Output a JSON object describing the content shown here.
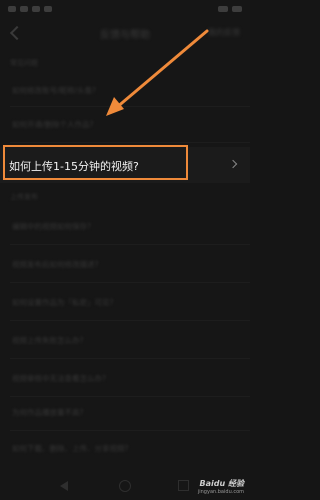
{
  "header": {
    "title": "反馈与帮助",
    "action": "我的反馈"
  },
  "sections": {
    "common": "常见问题",
    "upload": "上传发布"
  },
  "rows": [
    "如何修改账号/昵称/头像?",
    "如何开通/删除个人作品?",
    "如何上传1-15分钟的视频?",
    "编辑中的视频如何保存?",
    "视频发布后如何修改描述?",
    "如何设置作品为「私密」可见?",
    "视频上传失败怎么办?",
    "视频审核中无法查看怎么办?",
    "为何作品播放量不高?",
    "如何下载、删除、上传、分享视频?"
  ],
  "highlight": {
    "text": "如何上传1-15分钟的视频?"
  },
  "watermark": {
    "line1": "Baidu 经验",
    "line2": "jingyan.baidu.com"
  },
  "colors": {
    "annotation": "#ef8a3a",
    "background": "#161616"
  }
}
